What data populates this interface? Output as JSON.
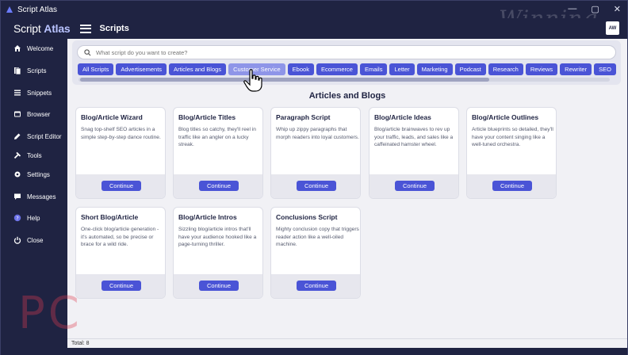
{
  "window": {
    "title": "Script Atlas",
    "controls": [
      "—",
      "▢",
      "✕"
    ],
    "watermark": "Winning"
  },
  "header": {
    "logo_light": "Script ",
    "logo_bold": "Atlas",
    "title": "Scripts",
    "avatar_text": "AW"
  },
  "sidebar": {
    "items": [
      {
        "label": "Welcome",
        "icon": "home-icon"
      },
      {
        "label": "Scripts",
        "icon": "scripts-icon"
      },
      {
        "label": "Snippets",
        "icon": "snippets-icon"
      },
      {
        "label": "Browser",
        "icon": "browser-icon"
      },
      {
        "label": "Script Editor",
        "icon": "edit-icon"
      },
      {
        "label": "Tools",
        "icon": "tools-icon"
      },
      {
        "label": "Settings",
        "icon": "gear-icon"
      },
      {
        "label": "Messages",
        "icon": "messages-icon"
      },
      {
        "label": "Help",
        "icon": "help-icon"
      },
      {
        "label": "Close",
        "icon": "power-icon"
      }
    ]
  },
  "search": {
    "placeholder": "What script do you want to create?"
  },
  "categories": [
    "All Scripts",
    "Advertisements",
    "Articles and Blogs",
    "Customer Service",
    "Ebook",
    "Ecommerce",
    "Emails",
    "Letter",
    "Marketing",
    "Podcast",
    "Research",
    "Reviews",
    "Rewriter",
    "SEO"
  ],
  "section_title": "Articles and Blogs",
  "cards": [
    {
      "title": "Blog/Article Wizard",
      "desc": "Snag top-shelf SEO articles in a simple step-by-step dance routine.",
      "button": "Continue"
    },
    {
      "title": "Blog/Article Titles",
      "desc": "Blog titles so catchy, they'll reel in traffic like an angler on a lucky streak.",
      "button": "Continue"
    },
    {
      "title": "Paragraph Script",
      "desc": "Whip up zippy paragraphs that morph readers into loyal customers.",
      "button": "Continue"
    },
    {
      "title": "Blog/Article Ideas",
      "desc": "Blog/article brainwaves to rev up your traffic, leads, and sales like a caffeinated hamster wheel.",
      "button": "Continue"
    },
    {
      "title": "Blog/Article Outlines",
      "desc": "Article blueprints so detailed, they'll have your content singing like a well-tuned orchestra.",
      "button": "Continue"
    },
    {
      "title": "Short Blog/Article",
      "desc": "One-click blog/article generation - it's automated, so be precise or brace for a wild ride.",
      "button": "Continue"
    },
    {
      "title": "Blog/Article Intros",
      "desc": "Sizzling blog/article intros that'll have your audience hooked like a page-turning thriller.",
      "button": "Continue"
    },
    {
      "title": "Conclusions Script",
      "desc": "Mighty conclusion copy that triggers reader action like a well-oiled machine.",
      "button": "Continue"
    }
  ],
  "status": {
    "total": "Total: 8"
  },
  "overlay": {
    "pc_mark": "PC"
  },
  "colors": {
    "sidebar_bg": "#1f2342",
    "accent": "#4a54d6",
    "hover_chip": "#8e95e8"
  }
}
